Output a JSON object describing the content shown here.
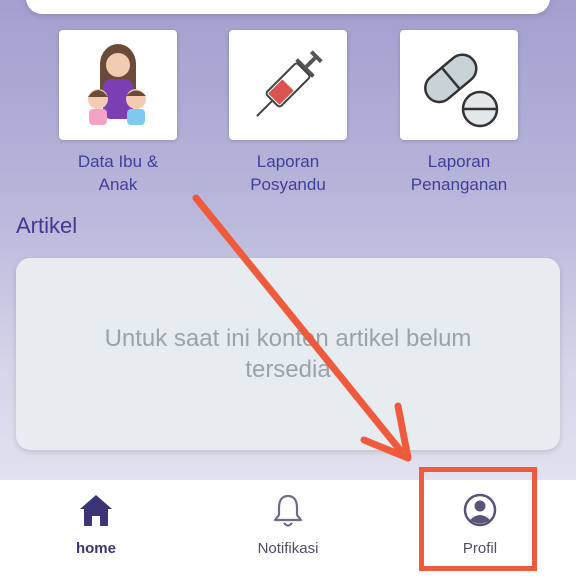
{
  "menu": [
    {
      "label": "Data Ibu &\nAnak",
      "icon": "mother-children-icon"
    },
    {
      "label": "Laporan\nPosyandu",
      "icon": "syringe-icon"
    },
    {
      "label": "Laporan\nPenanganan",
      "icon": "pills-icon"
    }
  ],
  "articles": {
    "title": "Artikel",
    "empty_message": "Untuk saat ini konten artikel belum tersedia"
  },
  "bottom_nav": [
    {
      "label": "home",
      "icon": "home-icon",
      "active": true
    },
    {
      "label": "Notifikasi",
      "icon": "bell-icon",
      "active": false
    },
    {
      "label": "Profil",
      "icon": "user-circle-icon",
      "active": false
    }
  ],
  "colors": {
    "accent": "#3e3a8f",
    "annotation": "#f05a3c"
  }
}
